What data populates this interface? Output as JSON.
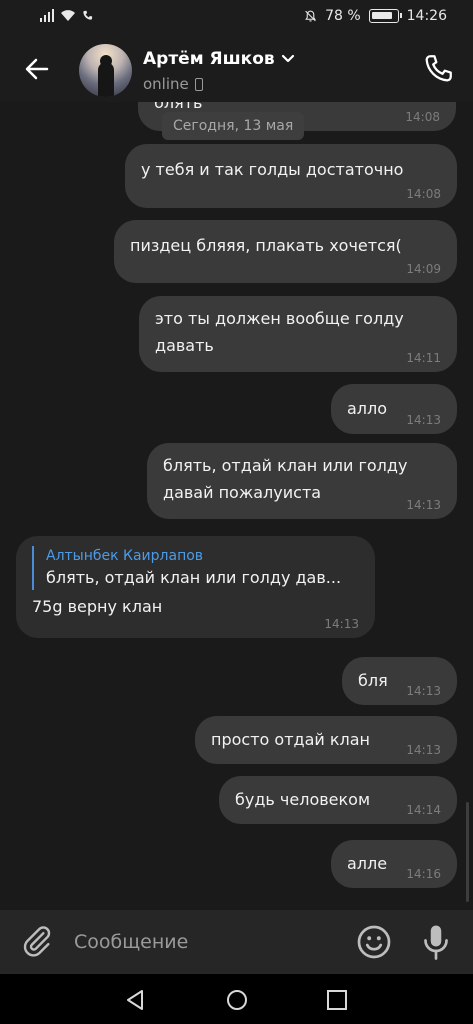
{
  "status_bar": {
    "battery_percent": "78 %",
    "time": "14:26",
    "icons": [
      "signal-icon",
      "wifi-icon",
      "call-status-icon",
      "mute-icon",
      "battery-icon"
    ]
  },
  "header": {
    "contact_name": "Артём Яшков",
    "contact_status": "online",
    "icons": [
      "back-arrow-icon",
      "chevron-down-icon",
      "mobile-device-icon",
      "phone-icon"
    ]
  },
  "chat": {
    "date_chip": "Сегодня, 13 мая",
    "messages": [
      {
        "text": "блять",
        "time": "14:08"
      },
      {
        "text": "у тебя и так голды достаточно",
        "time": "14:08"
      },
      {
        "text": "пиздец бляяя, плакать хочется(",
        "time": "14:09"
      },
      {
        "text": "это ты должен вообще голду\nдавать",
        "time": "14:11"
      },
      {
        "text": "алло",
        "time": "14:13"
      },
      {
        "text": "блять, отдай клан или голду\nдавай пожалуиста",
        "time": "14:13"
      },
      {
        "reply_author": "Алтынбек Каирлапов",
        "reply_text": "блять, отдай клан или голду дав...",
        "text": "75g верну клан",
        "time": "14:13"
      },
      {
        "text": "бля",
        "time": "14:13"
      },
      {
        "text": "просто отдай клан",
        "time": "14:13"
      },
      {
        "text": "будь человеком",
        "time": "14:14"
      },
      {
        "text": "алле",
        "time": "14:16"
      }
    ]
  },
  "input_bar": {
    "placeholder": "Сообщение",
    "icons": [
      "attach-icon",
      "emoji-icon",
      "microphone-icon"
    ]
  },
  "nav_bar": {
    "icons": [
      "nav-back-icon",
      "nav-home-icon",
      "nav-recent-icon"
    ]
  }
}
